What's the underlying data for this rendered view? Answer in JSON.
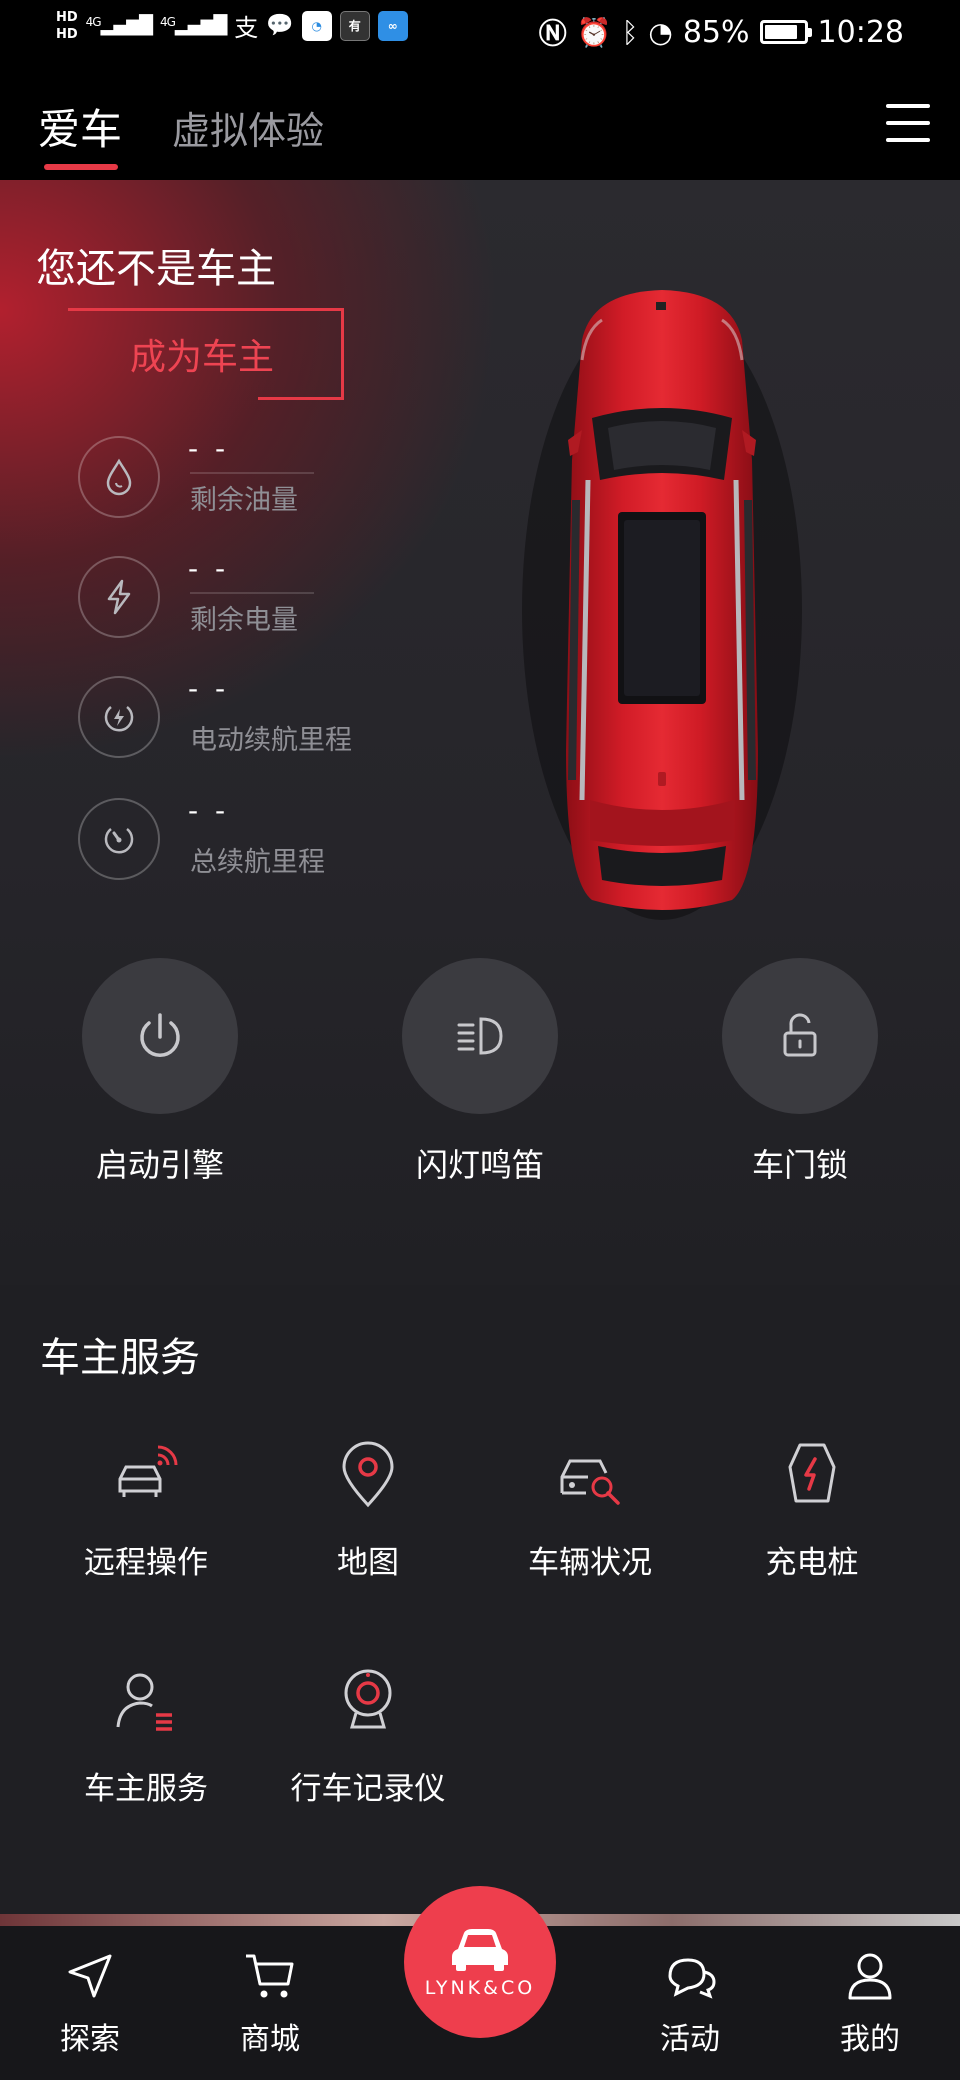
{
  "status_bar": {
    "hd1": "HD",
    "hd2": "HD",
    "signal1": "4G",
    "signal2": "4G",
    "battery_percent": "85%",
    "battery_level": 0.85,
    "time": "10:28"
  },
  "top_nav": {
    "tabs": [
      {
        "label": "爱车",
        "active": true
      },
      {
        "label": "虚拟体验",
        "active": false
      }
    ],
    "accent_color": "#e63946"
  },
  "owner": {
    "status_text": "您还不是车主",
    "become_owner_label": "成为车主"
  },
  "stats": [
    {
      "icon": "drop-icon",
      "value": "- -",
      "label": "剩余油量"
    },
    {
      "icon": "bolt-icon",
      "value": "- -",
      "label": "剩余电量"
    },
    {
      "icon": "electric-range-icon",
      "value": "- -",
      "label": "电动续航里程"
    },
    {
      "icon": "gauge-icon",
      "value": "- -",
      "label": "总续航里程"
    }
  ],
  "controls": [
    {
      "icon": "power-icon",
      "label": "启动引擎"
    },
    {
      "icon": "headlight-icon",
      "label": "闪灯鸣笛"
    },
    {
      "icon": "unlock-icon",
      "label": "车门锁"
    }
  ],
  "services": {
    "title": "车主服务",
    "items": [
      {
        "icon": "remote-car-icon",
        "label": "远程操作"
      },
      {
        "icon": "map-pin-icon",
        "label": "地图"
      },
      {
        "icon": "car-search-icon",
        "label": "车辆状况"
      },
      {
        "icon": "charger-icon",
        "label": "充电桩"
      },
      {
        "icon": "owner-service-icon",
        "label": "车主服务"
      },
      {
        "icon": "dashcam-icon",
        "label": "行车记录仪"
      }
    ]
  },
  "bottom_nav": {
    "items": [
      {
        "icon": "navigate-icon",
        "label": "探索"
      },
      {
        "icon": "cart-icon",
        "label": "商城"
      },
      {
        "icon": "chat-icon",
        "label": "活动"
      },
      {
        "icon": "user-icon",
        "label": "我的"
      }
    ],
    "center_logo": "LYNK&CO",
    "center_color": "#ee3e4d"
  }
}
